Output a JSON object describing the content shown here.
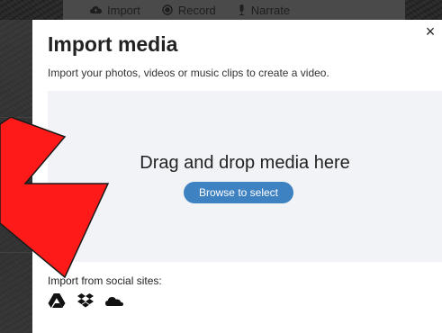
{
  "background_toolbar": {
    "import_label": "Import",
    "record_label": "Record",
    "narrate_label": "Narrate"
  },
  "modal": {
    "close_symbol": "×",
    "title": "Import media",
    "subtitle": "Import your photos, videos or music clips to create a video.",
    "dropzone": {
      "heading": "Drag and drop media here",
      "browse_label": "Browse to select"
    },
    "social": {
      "label": "Import from social sites:",
      "icons": [
        "google-drive-icon",
        "dropbox-icon",
        "onedrive-icon"
      ]
    }
  },
  "colors": {
    "accent": "#3f82c2",
    "annotation": "#ff1a1a",
    "dropzone_bg": "#f2f3f6"
  }
}
